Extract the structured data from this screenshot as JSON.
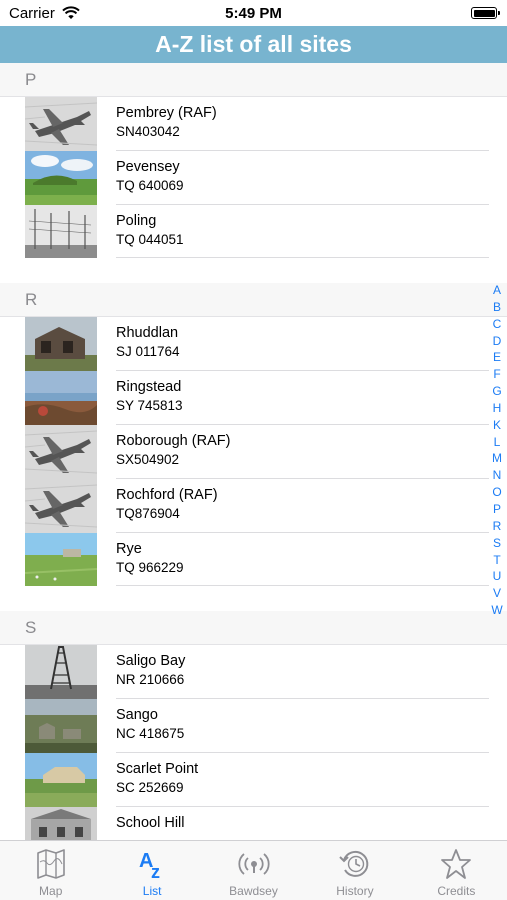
{
  "status_bar": {
    "carrier": "Carrier",
    "time": "5:49 PM"
  },
  "header": {
    "title": "A-Z list of all sites"
  },
  "sections": [
    {
      "letter": "P",
      "items": [
        {
          "name": "Pembrey (RAF)",
          "grid_ref": "SN403042",
          "thumb": "spitfire"
        },
        {
          "name": "Pevensey",
          "grid_ref": "TQ 640069",
          "thumb": "landscape"
        },
        {
          "name": "Poling",
          "grid_ref": "TQ 044051",
          "thumb": "masts"
        }
      ]
    },
    {
      "letter": "R",
      "items": [
        {
          "name": "Rhuddlan",
          "grid_ref": "SJ 011764",
          "thumb": "hut"
        },
        {
          "name": "Ringstead",
          "grid_ref": "SY 745813",
          "thumb": "coast"
        },
        {
          "name": "Roborough (RAF)",
          "grid_ref": "SX504902",
          "thumb": "spitfire"
        },
        {
          "name": "Rochford (RAF)",
          "grid_ref": "TQ876904",
          "thumb": "spitfire"
        },
        {
          "name": "Rye",
          "grid_ref": "TQ 966229",
          "thumb": "field"
        }
      ]
    },
    {
      "letter": "S",
      "items": [
        {
          "name": "Saligo Bay",
          "grid_ref": "NR 210666",
          "thumb": "tower"
        },
        {
          "name": "Sango",
          "grid_ref": "NC 418675",
          "thumb": "ruins"
        },
        {
          "name": "Scarlet Point",
          "grid_ref": "SC 252669",
          "thumb": "fort"
        },
        {
          "name": "School Hill",
          "grid_ref": "",
          "thumb": "building"
        }
      ]
    }
  ],
  "section_index": [
    "A",
    "B",
    "C",
    "D",
    "E",
    "F",
    "G",
    "H",
    "K",
    "L",
    "M",
    "N",
    "O",
    "P",
    "R",
    "S",
    "T",
    "U",
    "V",
    "W"
  ],
  "tabs": [
    {
      "label": "Map",
      "icon": "map-icon",
      "active": false
    },
    {
      "label": "List",
      "icon": "az-list-icon",
      "active": true
    },
    {
      "label": "Bawdsey",
      "icon": "radar-icon",
      "active": false
    },
    {
      "label": "History",
      "icon": "history-clock-icon",
      "active": false
    },
    {
      "label": "Credits",
      "icon": "star-icon",
      "active": false
    }
  ],
  "colors": {
    "header_bg": "#78b4cf",
    "accent": "#1c7cf4",
    "inactive": "#8e8e93"
  }
}
